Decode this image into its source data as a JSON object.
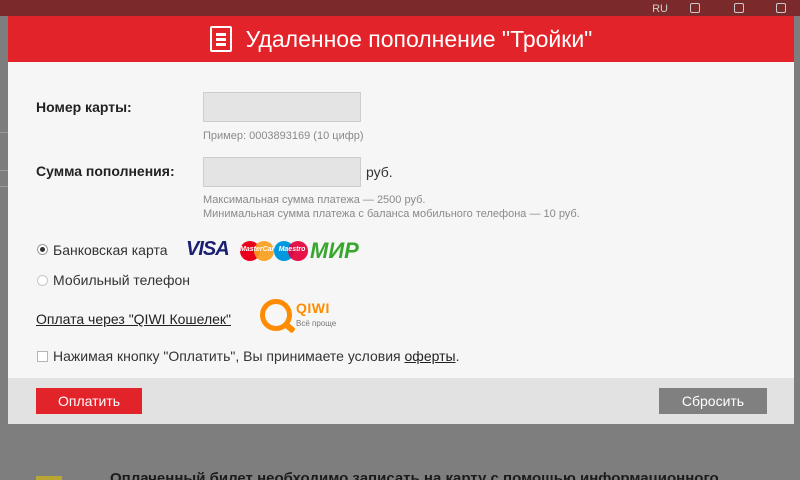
{
  "modal": {
    "title": "Удаленное пополнение \"Тройки\""
  },
  "form": {
    "card_number_label": "Номер карты:",
    "card_number_value": "",
    "card_number_hint": "Пример: 0003893169 (10 цифр)",
    "amount_label": "Сумма пополнения:",
    "amount_value": "",
    "amount_unit": "руб.",
    "amount_hint_max": "Максимальная сумма платежа — 2500 руб.",
    "amount_hint_min": "Минимальная сумма платежа с баланса мобильного телефона — 10 руб."
  },
  "payment_methods": [
    {
      "label": "Банковская карта",
      "selected": true,
      "enabled": true
    },
    {
      "label": "Мобильный телефон",
      "selected": false,
      "enabled": false
    }
  ],
  "card_logos": {
    "visa": "VISA",
    "mastercard": "MasterCard",
    "maestro": "Maestro",
    "mir": "МИР"
  },
  "qiwi": {
    "link_label": "Оплата через \"QIWI Кошелек\"",
    "logo_text": "QIWI",
    "logo_tagline": "Всё проще"
  },
  "agreement": {
    "checked": false,
    "text": "Нажимая кнопку \"Оплатить\", Вы принимаете условия ",
    "link_label": "оферты",
    "suffix": "."
  },
  "footer": {
    "pay_label": "Оплатить",
    "reset_label": "Сбросить"
  },
  "background": {
    "lang_code": "RU",
    "bottom_text": "Оплаченный билет необходимо записать на карту с помощью информационного"
  },
  "colors": {
    "brand_red": "#e3232a",
    "reset_gray": "#808080",
    "qiwi_orange": "#ff8c00",
    "mir_green": "#37a72e",
    "visa_blue": "#1a1f71"
  }
}
